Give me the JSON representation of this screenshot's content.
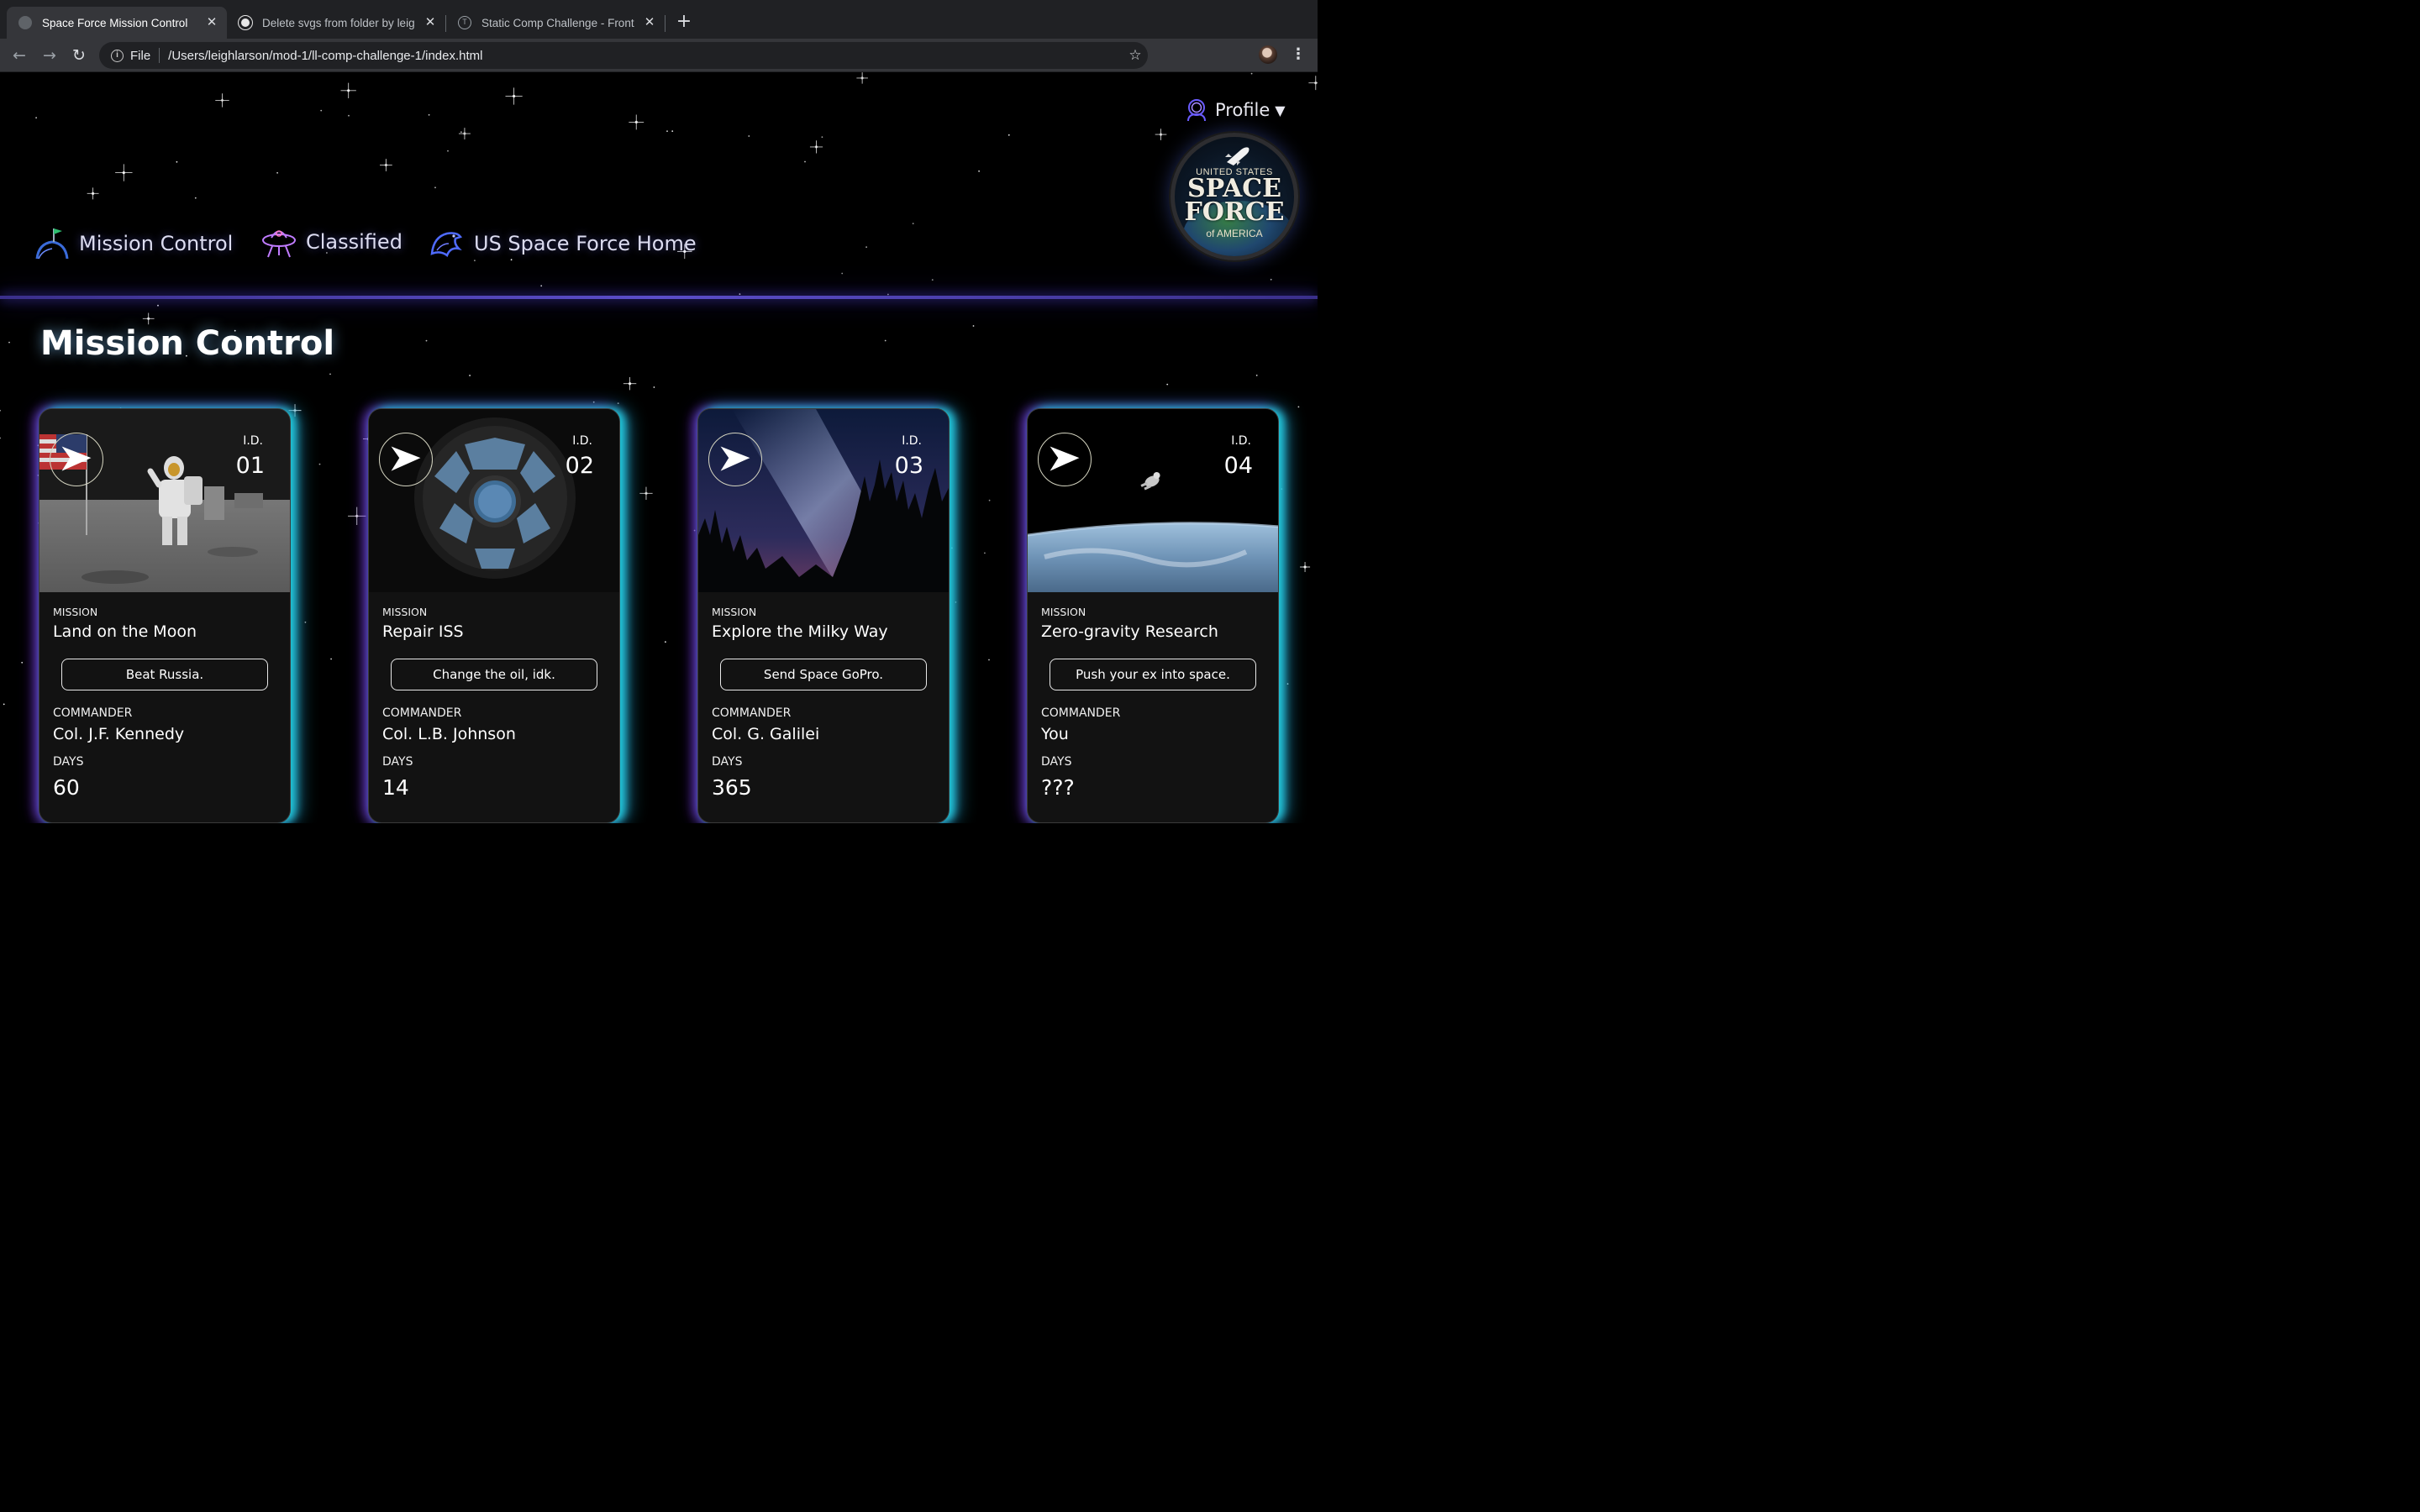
{
  "browser": {
    "tabs": [
      {
        "title": "Space Force Mission Control",
        "active": true
      },
      {
        "title": "Delete svgs from folder by leig",
        "active": false
      },
      {
        "title": "Static Comp Challenge - Front",
        "active": false
      }
    ],
    "address": {
      "scheme": "File",
      "url": "/Users/leighlarson/mod-1/ll-comp-challenge-1/index.html"
    }
  },
  "header": {
    "profile_label": "Profile",
    "logo": {
      "line1": "UNITED STATES",
      "line2": "SPACE",
      "line3": "FORCE",
      "line4": "of AMERICA"
    },
    "nav": [
      {
        "label": "Mission Control",
        "icon": "planet-flag-icon"
      },
      {
        "label": "Classified",
        "icon": "ufo-icon"
      },
      {
        "label": "US Space Force Home",
        "icon": "eagle-icon"
      }
    ]
  },
  "main": {
    "title": "Mission Control",
    "cards": [
      {
        "id_label": "I.D.",
        "id": "01",
        "mission_label": "MISSION",
        "mission": "Land on the Moon",
        "objective": "Beat Russia.",
        "commander_label": "COMMANDER",
        "commander": "Col. J.F. Kennedy",
        "days_label": "DAYS",
        "days": "60"
      },
      {
        "id_label": "I.D.",
        "id": "02",
        "mission_label": "MISSION",
        "mission": "Repair ISS",
        "objective": "Change the oil, idk.",
        "commander_label": "COMMANDER",
        "commander": "Col. L.B. Johnson",
        "days_label": "DAYS",
        "days": "14"
      },
      {
        "id_label": "I.D.",
        "id": "03",
        "mission_label": "MISSION",
        "mission": "Explore the Milky Way",
        "objective": "Send Space GoPro.",
        "commander_label": "COMMANDER",
        "commander": "Col. G. Galilei",
        "days_label": "DAYS",
        "days": "365"
      },
      {
        "id_label": "I.D.",
        "id": "04",
        "mission_label": "MISSION",
        "mission": "Zero-gravity Research",
        "objective": "Push your ex into space.",
        "commander_label": "COMMANDER",
        "commander": "You",
        "days_label": "DAYS",
        "days": "???"
      }
    ]
  },
  "colors": {
    "accent_cyan": "#1ec8d8",
    "accent_purple": "#8c3cff",
    "header_line": "#5a4dc8",
    "card_bg": "#121212"
  }
}
